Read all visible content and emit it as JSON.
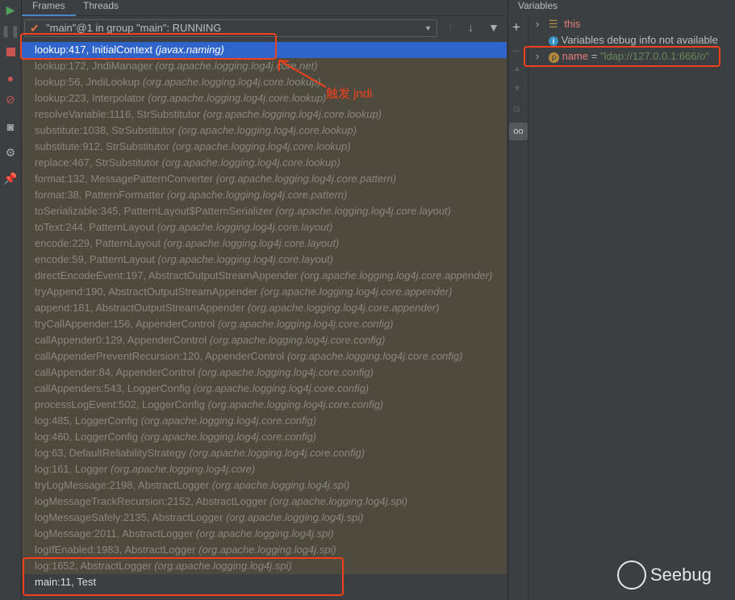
{
  "tabs": [
    "Frames",
    "Threads"
  ],
  "thread_selector": "\"main\"@1 in group \"main\": RUNNING",
  "frames": [
    {
      "method": "lookup:417, InitialContext",
      "pkg": "(javax.naming)",
      "state": "selected"
    },
    {
      "method": "lookup:172, JndiManager",
      "pkg": "(org.apache.logging.log4j.core.net)"
    },
    {
      "method": "lookup:56, JndiLookup",
      "pkg": "(org.apache.logging.log4j.core.lookup)"
    },
    {
      "method": "lookup:223, Interpolator",
      "pkg": "(org.apache.logging.log4j.core.lookup)"
    },
    {
      "method": "resolveVariable:1116, StrSubstitutor",
      "pkg": "(org.apache.logging.log4j.core.lookup)"
    },
    {
      "method": "substitute:1038, StrSubstitutor",
      "pkg": "(org.apache.logging.log4j.core.lookup)"
    },
    {
      "method": "substitute:912, StrSubstitutor",
      "pkg": "(org.apache.logging.log4j.core.lookup)"
    },
    {
      "method": "replace:467, StrSubstitutor",
      "pkg": "(org.apache.logging.log4j.core.lookup)"
    },
    {
      "method": "format:132, MessagePatternConverter",
      "pkg": "(org.apache.logging.log4j.core.pattern)"
    },
    {
      "method": "format:38, PatternFormatter",
      "pkg": "(org.apache.logging.log4j.core.pattern)"
    },
    {
      "method": "toSerializable:345, PatternLayout$PatternSerializer",
      "pkg": "(org.apache.logging.log4j.core.layout)"
    },
    {
      "method": "toText:244, PatternLayout",
      "pkg": "(org.apache.logging.log4j.core.layout)"
    },
    {
      "method": "encode:229, PatternLayout",
      "pkg": "(org.apache.logging.log4j.core.layout)"
    },
    {
      "method": "encode:59, PatternLayout",
      "pkg": "(org.apache.logging.log4j.core.layout)"
    },
    {
      "method": "directEncodeEvent:197, AbstractOutputStreamAppender",
      "pkg": "(org.apache.logging.log4j.core.appender)"
    },
    {
      "method": "tryAppend:190, AbstractOutputStreamAppender",
      "pkg": "(org.apache.logging.log4j.core.appender)"
    },
    {
      "method": "append:181, AbstractOutputStreamAppender",
      "pkg": "(org.apache.logging.log4j.core.appender)"
    },
    {
      "method": "tryCallAppender:156, AppenderControl",
      "pkg": "(org.apache.logging.log4j.core.config)"
    },
    {
      "method": "callAppender0:129, AppenderControl",
      "pkg": "(org.apache.logging.log4j.core.config)"
    },
    {
      "method": "callAppenderPreventRecursion:120, AppenderControl",
      "pkg": "(org.apache.logging.log4j.core.config)"
    },
    {
      "method": "callAppender:84, AppenderControl",
      "pkg": "(org.apache.logging.log4j.core.config)"
    },
    {
      "method": "callAppenders:543, LoggerConfig",
      "pkg": "(org.apache.logging.log4j.core.config)"
    },
    {
      "method": "processLogEvent:502, LoggerConfig",
      "pkg": "(org.apache.logging.log4j.core.config)"
    },
    {
      "method": "log:485, LoggerConfig",
      "pkg": "(org.apache.logging.log4j.core.config)"
    },
    {
      "method": "log:460, LoggerConfig",
      "pkg": "(org.apache.logging.log4j.core.config)"
    },
    {
      "method": "log:63, DefaultReliabilityStrategy",
      "pkg": "(org.apache.logging.log4j.core.config)"
    },
    {
      "method": "log:161, Logger",
      "pkg": "(org.apache.logging.log4j.core)"
    },
    {
      "method": "tryLogMessage:2198, AbstractLogger",
      "pkg": "(org.apache.logging.log4j.spi)"
    },
    {
      "method": "logMessageTrackRecursion:2152, AbstractLogger",
      "pkg": "(org.apache.logging.log4j.spi)"
    },
    {
      "method": "logMessageSafely:2135, AbstractLogger",
      "pkg": "(org.apache.logging.log4j.spi)"
    },
    {
      "method": "logMessage:2011, AbstractLogger",
      "pkg": "(org.apache.logging.log4j.spi)"
    },
    {
      "method": "logIfEnabled:1983, AbstractLogger",
      "pkg": "(org.apache.logging.log4j.spi)"
    },
    {
      "method": "log:1652, AbstractLogger",
      "pkg": "(org.apache.logging.log4j.spi)"
    },
    {
      "method": "main:11, Test",
      "pkg": "",
      "state": "plain"
    }
  ],
  "annotation": "触发 jndi",
  "variables": {
    "title": "Variables",
    "this_label": "this",
    "info": "Variables debug info not available",
    "var_name": "name",
    "var_eq": "=",
    "var_value": "\"ldap://127.0.0.1:666/o\""
  },
  "watermark": "Seebug",
  "colors": {
    "selected": "#2f65ca",
    "library_bg": "#4f4a3e",
    "highlight": "#f0401c"
  }
}
